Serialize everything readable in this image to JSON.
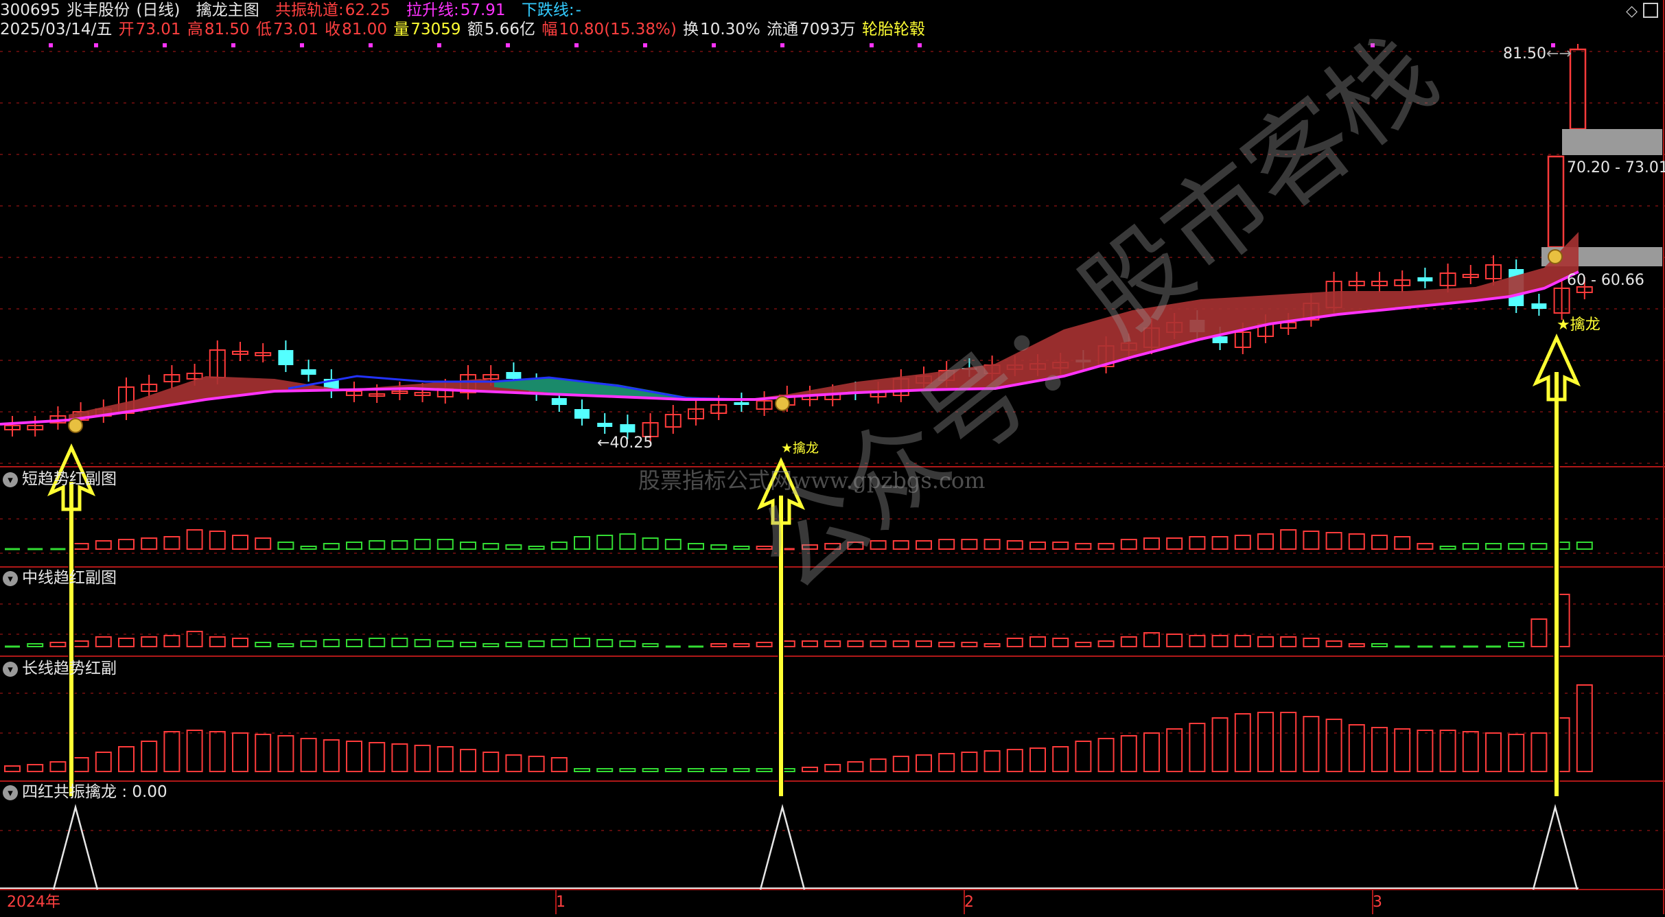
{
  "header": {
    "code": "300695",
    "name": "兆丰股份",
    "period": "(日线)",
    "template": "擒龙主图",
    "resonance_label": "共振轨道:",
    "resonance_value": "62.25",
    "pull_label": "拉升线:",
    "pull_value": "57.91",
    "down_label": "下跌线:",
    "down_value": "-",
    "date": "2025/03/14/五",
    "open_label": "开",
    "open_value": "73.01",
    "high_label": "高",
    "high_value": "81.50",
    "low_label": "低",
    "low_value": "73.01",
    "close_label": "收",
    "close_value": "81.00",
    "vol_label": "量",
    "vol_value": "73059",
    "amount_label": "额",
    "amount_value": "5.66亿",
    "change_label": "幅",
    "change_value": "10.80(15.38%)",
    "turnover_label": "换",
    "turnover_value": "10.30%",
    "float_label": "流通",
    "float_value": "7093万",
    "sector": "轮胎轮毂"
  },
  "main_chart": {
    "high_label": "81.50",
    "low_label": "40.25",
    "zone_upper_label": "70.20 - 73.01",
    "zone_lower_label": "60 - 60.66",
    "signal_label": "★擒龙",
    "signal_label_mid": "★擒龙"
  },
  "panes": {
    "short_trend": "短趋势红副图",
    "mid_trend": "中线趋红副图",
    "long_trend": "长线趋势红副",
    "resonance": "四红共振擒龙",
    "resonance_value": ": 0.00"
  },
  "x_axis": {
    "labels": [
      "2024年",
      "1",
      "2",
      "3"
    ]
  },
  "watermark": {
    "site": "股票指标公式网www.gpzbgs.com",
    "account": "公众号：股市客栈"
  },
  "colors": {
    "up": "#ff3b3b",
    "down": "#54ffff",
    "pink_line": "#ff33ff",
    "blue_line": "#2233ff",
    "band_red": "#a83232",
    "band_green": "#1a8a6a",
    "grid": "#7a1010",
    "arrow": "#ffff33",
    "neg_bar": "#33dd33"
  }
}
